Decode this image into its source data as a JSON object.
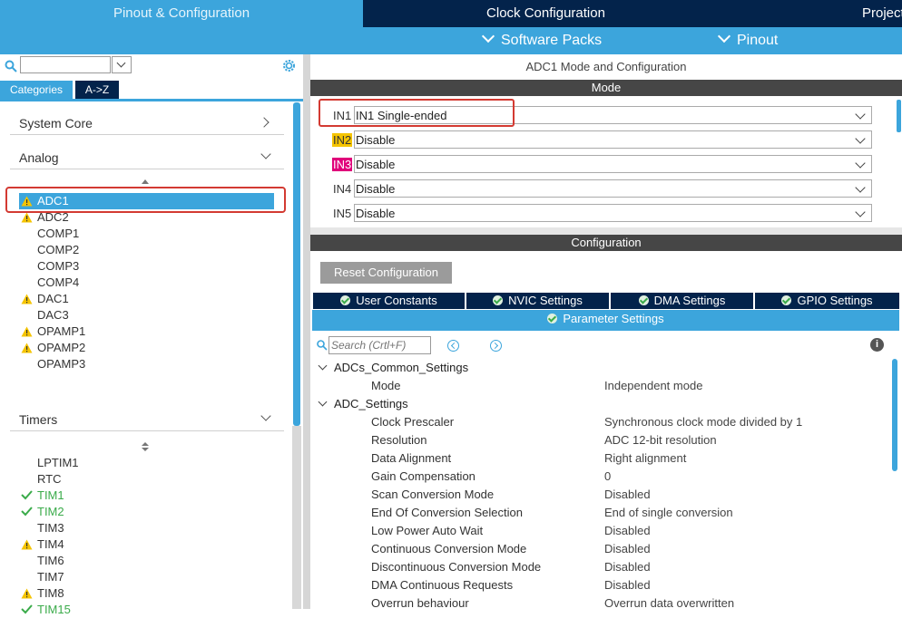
{
  "top_tabs": {
    "pinout": "Pinout & Configuration",
    "clock": "Clock Configuration",
    "project": "Project"
  },
  "sub_menu": {
    "software_packs": "Software Packs",
    "pinout": "Pinout"
  },
  "left": {
    "tabs": {
      "categories": "Categories",
      "az": "A->Z"
    },
    "categories": {
      "system_core": "System Core",
      "analog": "Analog",
      "timers": "Timers"
    },
    "analog_items": [
      {
        "label": "ADC1",
        "status": "warning",
        "selected": true
      },
      {
        "label": "ADC2",
        "status": "warning"
      },
      {
        "label": "COMP1",
        "status": "none"
      },
      {
        "label": "COMP2",
        "status": "none"
      },
      {
        "label": "COMP3",
        "status": "none"
      },
      {
        "label": "COMP4",
        "status": "none"
      },
      {
        "label": "DAC1",
        "status": "warning"
      },
      {
        "label": "DAC3",
        "status": "none"
      },
      {
        "label": "OPAMP1",
        "status": "warning"
      },
      {
        "label": "OPAMP2",
        "status": "warning"
      },
      {
        "label": "OPAMP3",
        "status": "none"
      }
    ],
    "timer_items": [
      {
        "label": "LPTIM1",
        "status": "none"
      },
      {
        "label": "RTC",
        "status": "none"
      },
      {
        "label": "TIM1",
        "status": "ok"
      },
      {
        "label": "TIM2",
        "status": "ok"
      },
      {
        "label": "TIM3",
        "status": "none"
      },
      {
        "label": "TIM4",
        "status": "warning"
      },
      {
        "label": "TIM6",
        "status": "none"
      },
      {
        "label": "TIM7",
        "status": "none"
      },
      {
        "label": "TIM8",
        "status": "warning"
      },
      {
        "label": "TIM15",
        "status": "ok"
      }
    ]
  },
  "right": {
    "title": "ADC1 Mode and Configuration",
    "mode_header": "Mode",
    "inputs": [
      {
        "label": "IN1",
        "value": "IN1 Single-ended",
        "highlight": ""
      },
      {
        "label": "IN2",
        "value": "Disable",
        "highlight": "#f5c400"
      },
      {
        "label": "IN3",
        "value": "Disable",
        "highlight": "#e0007a"
      },
      {
        "label": "IN4",
        "value": "Disable",
        "highlight": ""
      },
      {
        "label": "IN5",
        "value": "Disable",
        "highlight": ""
      }
    ],
    "config_header": "Configuration",
    "reset_button": "Reset Configuration",
    "tabs": {
      "user_constants": "User Constants",
      "nvic": "NVIC Settings",
      "dma": "DMA Settings",
      "gpio": "GPIO Settings",
      "parameter": "Parameter Settings"
    },
    "search_placeholder": "Search (Crtl+F)",
    "groups": {
      "common": "ADCs_Common_Settings",
      "adc": "ADC_Settings"
    },
    "common_params": [
      {
        "name": "Mode",
        "value": "Independent mode"
      }
    ],
    "adc_params": [
      {
        "name": "Clock Prescaler",
        "value": "Synchronous clock mode divided by 1"
      },
      {
        "name": "Resolution",
        "value": "ADC 12-bit resolution"
      },
      {
        "name": "Data Alignment",
        "value": "Right alignment"
      },
      {
        "name": "Gain Compensation",
        "value": "0"
      },
      {
        "name": "Scan Conversion Mode",
        "value": "Disabled"
      },
      {
        "name": "End Of Conversion Selection",
        "value": "End of single conversion"
      },
      {
        "name": "Low Power Auto Wait",
        "value": "Disabled"
      },
      {
        "name": "Continuous Conversion Mode",
        "value": "Disabled"
      },
      {
        "name": "Discontinuous Conversion Mode",
        "value": "Disabled"
      },
      {
        "name": "DMA Continuous Requests",
        "value": "Disabled"
      },
      {
        "name": "Overrun behaviour",
        "value": "Overrun data overwritten"
      }
    ]
  },
  "colors": {
    "accent": "#3ca5dc",
    "navy": "#03234b",
    "warning": "#f5c400",
    "ok": "#3aab4a",
    "annotation": "#d33a32"
  }
}
